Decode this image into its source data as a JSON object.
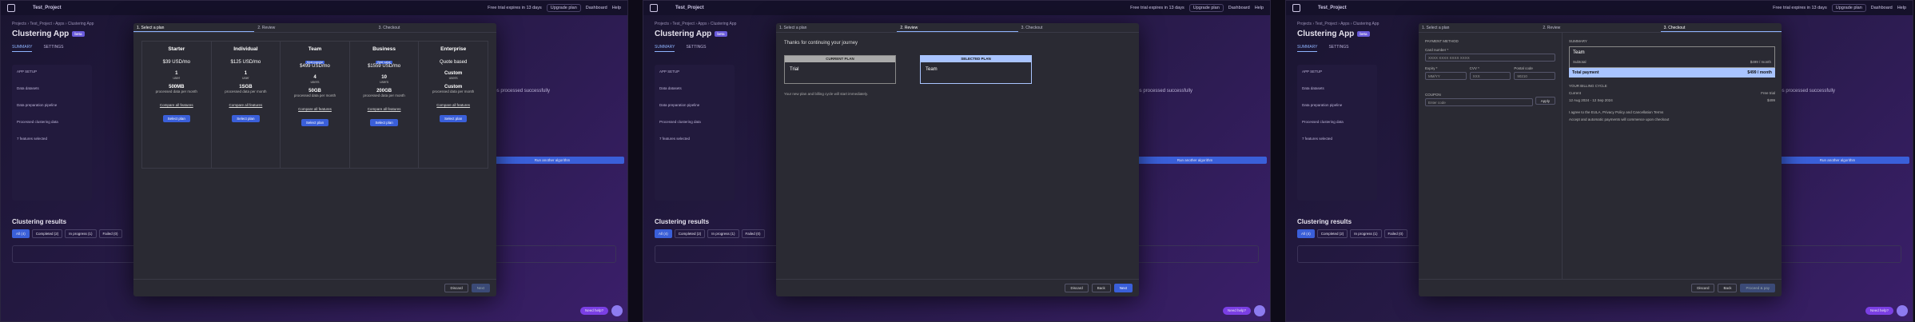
{
  "topbar": {
    "project": "Test_Project",
    "trial": "Free trial expires in 13 days",
    "upgrade": "Upgrade plan",
    "user": "Dashboard",
    "help": "Help"
  },
  "page": {
    "crumbs": "Projects  ›  Test_Project  ›  Apps  ›  Clustering App",
    "title": "Clustering App",
    "badge": "beta",
    "tab_summary": "SUMMARY",
    "tab_settings": "SETTINGS"
  },
  "side": {
    "setup": "APP SETUP",
    "setup_sub": "Create another app using this setup",
    "item1": "Data datasets",
    "item2": "Data preparation pipeline",
    "item3": "Processed clustering data",
    "item4": "Selected features",
    "features_selected": "7 features selected",
    "view_more": "View more"
  },
  "right": {
    "processed": "Features processed successfully",
    "cta": "Run another algorithm"
  },
  "results": {
    "title": "Clustering results",
    "filters": [
      "All (4)",
      "Completed (2)",
      "In progress (1)",
      "Failed (0)"
    ],
    "algorithm": "Algorithm: All"
  },
  "chat": {
    "label": "Need help?"
  },
  "steps": [
    "1. Select a plan",
    "2. Review",
    "3. Checkout"
  ],
  "plans": [
    {
      "name": "Starter",
      "price": "$39 USD/mo",
      "users": "1",
      "users_label": "user",
      "data": "500MB",
      "data_label": "processed data per month",
      "compare": "Compare all features",
      "select": "Select plan"
    },
    {
      "name": "Individual",
      "price": "$125 USD/mo",
      "users": "1",
      "users_label": "user",
      "data": "1SGB",
      "data_label": "processed data per month",
      "compare": "Compare all features",
      "select": "Select plan"
    },
    {
      "name": "Team",
      "price": "$499 USD/mo",
      "users": "4",
      "users_label": "users",
      "data": "50GB",
      "data_label": "processed data per month",
      "compare": "Compare all features",
      "select": "Select plan",
      "tag": "Most popular"
    },
    {
      "name": "Business",
      "price": "$1559 USD/mo",
      "users": "10",
      "users_label": "users",
      "data": "200GB",
      "data_label": "processed data per month",
      "compare": "Compare all features",
      "select": "Select plan",
      "tag": "Best value"
    },
    {
      "name": "Enterprise",
      "price": "Quote based",
      "users": "Custom",
      "users_label": "users",
      "data": "Custom",
      "data_label": "processed data per month",
      "compare": "Compare all features",
      "select": "Select plan"
    }
  ],
  "review": {
    "thanks": "Thanks for continuing your journey",
    "current": "CURRENT PLAN",
    "selected": "SELECTED PLAN",
    "current_name": "Trial",
    "selected_name": "Team",
    "note": "Your new plan and billing cycle will start immediately."
  },
  "checkout": {
    "payment": "PAYMENT METHOD",
    "card_label": "Card number *",
    "card_ph": "XXXX XXXX XXXX XXXX",
    "autofill": "Autofill link",
    "expiry_label": "Expiry *",
    "expiry_ph": "MM/YY",
    "cvv_label": "CVV *",
    "cvv_ph": "XXX",
    "postal_label": "Postal code",
    "postal_val": "90210",
    "coupon_label": "COUPON",
    "coupon_ph": "Enter code",
    "apply": "Apply",
    "summary": "SUMMARY",
    "plan": "Team",
    "subtotal_label": "Subtotal",
    "subtotal": "$499 / month",
    "total_label": "Total payment",
    "total": "$499 / month",
    "cycle": "YOUR BILLING CYCLE",
    "current_row": "Current",
    "current_val": "Free trial",
    "next_row": "12 Aug 2024 - 12 Sep 2024",
    "next_val": "$499",
    "agree": "I agree to the EULA, Privacy Policy and Cancellation Terms",
    "auto": "Accept and automatic payments will commence upon checkout",
    "pay": "Proceed & pay"
  },
  "footer": {
    "discard": "Discard",
    "back": "Back",
    "next": "Next"
  }
}
